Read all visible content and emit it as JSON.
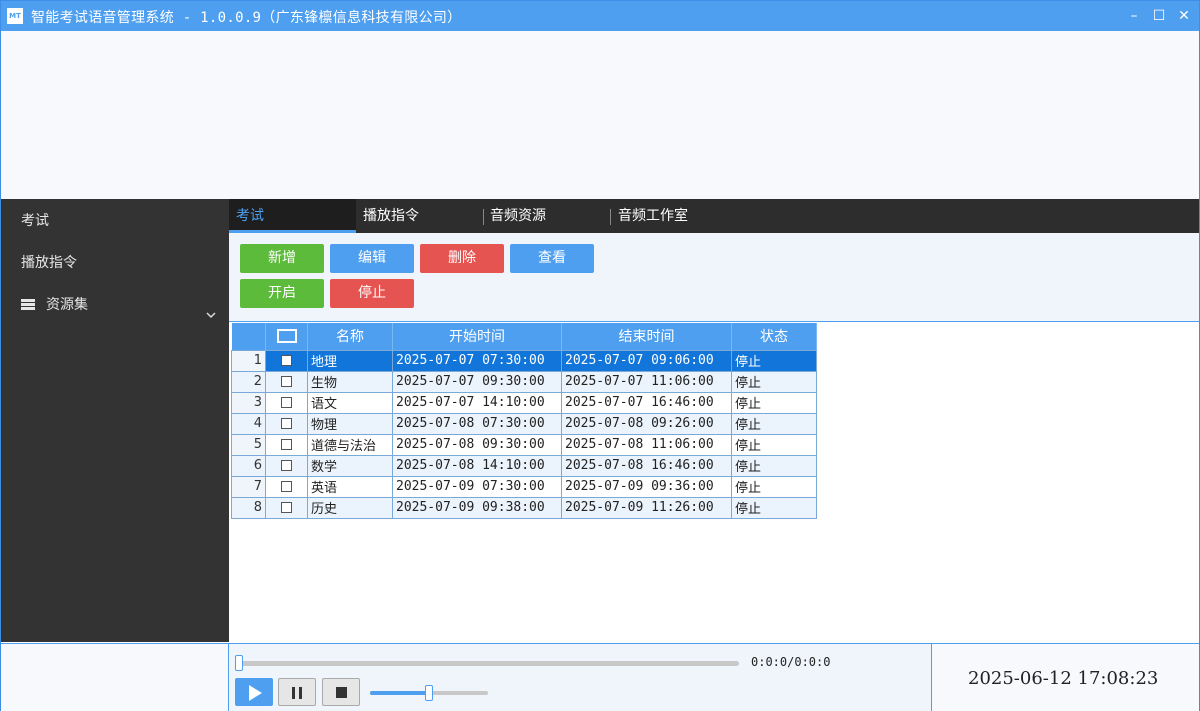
{
  "app": {
    "logo_text": "MT",
    "title": "智能考试语音管理系统 - 1.0.0.9（广东锋檩信息科技有限公司）",
    "minimize": "–",
    "maximize": "☐",
    "close": "✕"
  },
  "sidebar": {
    "items": [
      {
        "label": "考试"
      },
      {
        "label": "播放指令"
      },
      {
        "label": "资源集",
        "icon": "list-icon",
        "chevron": "chevron-down-icon"
      }
    ]
  },
  "tabs": [
    {
      "label": "考试",
      "active": true
    },
    {
      "label": "播放指令",
      "active": false
    },
    {
      "label": "音频资源",
      "active": false
    },
    {
      "label": "音频工作室",
      "active": false
    }
  ],
  "toolbar": {
    "add": "新增",
    "edit": "编辑",
    "delete": "删除",
    "view": "查看",
    "start": "开启",
    "stop": "停止"
  },
  "table": {
    "columns": [
      "名称",
      "开始时间",
      "结束时间",
      "状态"
    ],
    "rows": [
      {
        "n": "1",
        "name": "地理",
        "start": "2025-07-07 07:30:00",
        "end": "2025-07-07 09:06:00",
        "status": "停止",
        "selected": true
      },
      {
        "n": "2",
        "name": "生物",
        "start": "2025-07-07 09:30:00",
        "end": "2025-07-07 11:06:00",
        "status": "停止"
      },
      {
        "n": "3",
        "name": "语文",
        "start": "2025-07-07 14:10:00",
        "end": "2025-07-07 16:46:00",
        "status": "停止"
      },
      {
        "n": "4",
        "name": "物理",
        "start": "2025-07-08 07:30:00",
        "end": "2025-07-08 09:26:00",
        "status": "停止"
      },
      {
        "n": "5",
        "name": "道德与法治",
        "start": "2025-07-08 09:30:00",
        "end": "2025-07-08 11:06:00",
        "status": "停止"
      },
      {
        "n": "6",
        "name": "数学",
        "start": "2025-07-08 14:10:00",
        "end": "2025-07-08 16:46:00",
        "status": "停止"
      },
      {
        "n": "7",
        "name": "英语",
        "start": "2025-07-09 07:30:00",
        "end": "2025-07-09 09:36:00",
        "status": "停止"
      },
      {
        "n": "8",
        "name": "历史",
        "start": "2025-07-09 09:38:00",
        "end": "2025-07-09 11:26:00",
        "status": "停止"
      }
    ]
  },
  "player": {
    "time": "0:0:0/0:0:0",
    "progress": 0,
    "volume": 0.5
  },
  "clock": "2025-06-12 17:08:23",
  "colors": {
    "accent": "#4f9ff0",
    "green": "#5cbb3a",
    "red": "#e55451",
    "sidebar": "#333333",
    "selected_row": "#1175d9"
  }
}
